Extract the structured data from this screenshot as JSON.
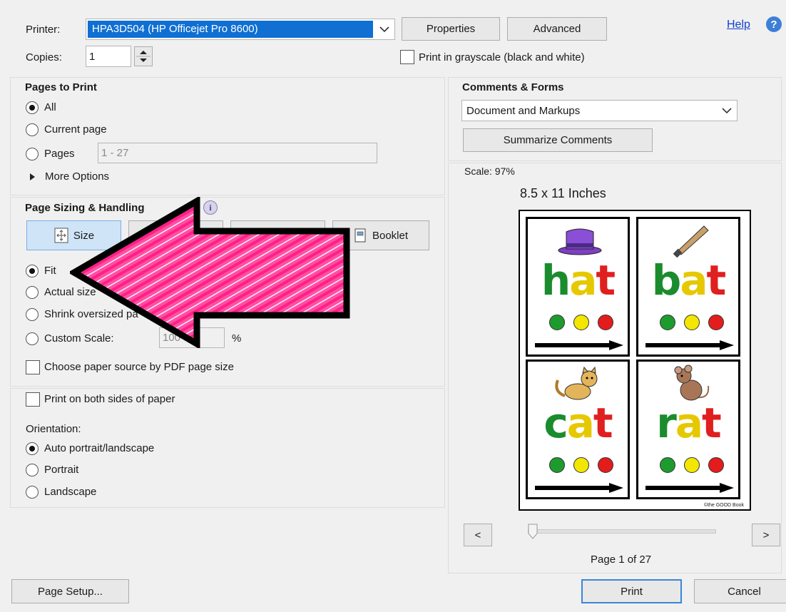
{
  "top": {
    "printer_label": "Printer:",
    "printer_value": "HPA3D504 (HP Officejet Pro 8600)",
    "properties_label": "Properties",
    "advanced_label": "Advanced",
    "help_label": "Help",
    "copies_label": "Copies:",
    "copies_value": "1",
    "grayscale_label": "Print in grayscale (black and white)"
  },
  "pages_to_print": {
    "title": "Pages to Print",
    "all": "All",
    "current": "Current page",
    "pages": "Pages",
    "pages_value": "1 - 27",
    "more_options": "More Options"
  },
  "sizing": {
    "title": "Page Sizing & Handling",
    "size_tab": "Size",
    "booklet_tab": "Booklet",
    "fit": "Fit",
    "actual": "Actual size",
    "shrink": "Shrink oversized pa",
    "custom": "Custom Scale:",
    "custom_value": "100",
    "percent": "%",
    "paper_source": "Choose paper source by PDF page size"
  },
  "duplex": {
    "both_sides": "Print on both sides of paper",
    "orientation_label": "Orientation:",
    "auto": "Auto portrait/landscape",
    "portrait": "Portrait",
    "landscape": "Landscape"
  },
  "comments": {
    "title": "Comments & Forms",
    "value": "Document and Markups",
    "summarize": "Summarize Comments"
  },
  "preview": {
    "scale": "Scale:  97%",
    "paper": "8.5 x 11 Inches",
    "prev": "<",
    "next": ">",
    "page_info": "Page 1 of 27",
    "copyright": "©the GOOD Book",
    "cards": [
      {
        "word": [
          "h",
          "a",
          "t"
        ],
        "colors": [
          "#1a8c2e",
          "#e6c800",
          "#e01f1f"
        ],
        "picture": "hat-icon"
      },
      {
        "word": [
          "b",
          "a",
          "t"
        ],
        "colors": [
          "#1a8c2e",
          "#e6c800",
          "#e01f1f"
        ],
        "picture": "bat-icon"
      },
      {
        "word": [
          "c",
          "a",
          "t"
        ],
        "colors": [
          "#1a8c2e",
          "#e6c800",
          "#e01f1f"
        ],
        "picture": "cat-icon"
      },
      {
        "word": [
          "r",
          "a",
          "t"
        ],
        "colors": [
          "#1a8c2e",
          "#e6c800",
          "#e01f1f"
        ],
        "picture": "rat-icon"
      }
    ],
    "dot_colors": [
      "#1e9b2f",
      "#f3e600",
      "#e51c1c"
    ]
  },
  "bottom": {
    "page_setup": "Page Setup...",
    "print": "Print",
    "cancel": "Cancel"
  },
  "colors": {
    "accent": "#0f6fd3",
    "arrow_fill": "#ff2f8f",
    "printer_select_bg": "#0f6fd3"
  }
}
